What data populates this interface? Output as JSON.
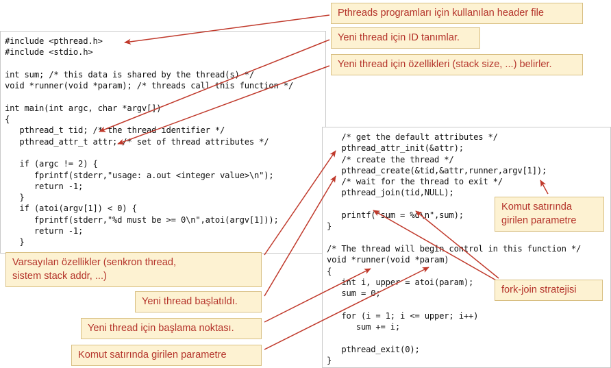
{
  "slide": {
    "title": "Pthreads example program with Turkish annotations",
    "background_color": "#ffffff"
  },
  "colors": {
    "callout_background": "#fdf2d2",
    "callout_border": "#d8bf82",
    "callout_text": "#b4332a",
    "arrow": "#c0392b",
    "code_text": "#101010",
    "code_panel_border": "#c9c9c9",
    "code_panel_background": "#ffffff"
  },
  "code_panels": {
    "left": {
      "name": "main-function-code",
      "language": "c",
      "text": "#include <pthread.h>\n#include <stdio.h>\n\nint sum; /* this data is shared by the thread(s) */\nvoid *runner(void *param); /* threads call this function */\n\nint main(int argc, char *argv[])\n{\n   pthread_t tid; /* the thread identifier */\n   pthread_attr_t attr; /* set of thread attributes */\n\n   if (argc != 2) {\n      fprintf(stderr,\"usage: a.out <integer value>\\n\");\n      return -1;\n   }\n   if (atoi(argv[1]) < 0) {\n      fprintf(stderr,\"%d must be >= 0\\n\",atoi(argv[1]));\n      return -1;\n   }"
    },
    "right": {
      "name": "thread-create-and-runner-code",
      "language": "c",
      "text": "   /* get the default attributes */\n   pthread_attr_init(&attr);\n   /* create the thread */\n   pthread_create(&tid,&attr,runner,argv[1]);\n   /* wait for the thread to exit */\n   pthread_join(tid,NULL);\n\n   printf(\"sum = %d\\n\",sum);\n}\n\n/* The thread will begin control in this function */\nvoid *runner(void *param)\n{\n   int i, upper = atoi(param);\n   sum = 0;\n\n   for (i = 1; i <= upper; i++)\n      sum += i;\n\n   pthread_exit(0);\n}"
    }
  },
  "callouts": [
    {
      "id": "header-file",
      "text": "Pthreads programları için kullanılan header file"
    },
    {
      "id": "thread-id",
      "text": "Yeni thread için ID tanımlar."
    },
    {
      "id": "thread-attrs",
      "text": "Yeni thread için özellikleri (stack size, ...) belirler."
    },
    {
      "id": "cmdline-right",
      "text": "Komut satırında girilen parametre"
    },
    {
      "id": "fork-join",
      "text": "fork-join stratejisi"
    },
    {
      "id": "default-attrs",
      "text": "Varsayılan özellikler (senkron thread,\nsistem stack addr, ...)"
    },
    {
      "id": "thread-start",
      "text": "Yeni thread başlatıldı."
    },
    {
      "id": "start-point",
      "text": "Yeni thread için başlama noktası."
    },
    {
      "id": "cmdline-left",
      "text": "Komut satırında girilen parametre"
    }
  ]
}
